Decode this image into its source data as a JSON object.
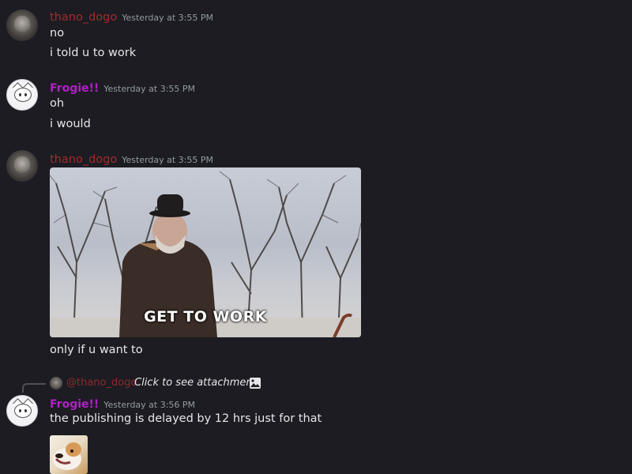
{
  "messages": [
    {
      "username": "thano_dogo",
      "timestamp": "Yesterday at 3:55 PM",
      "lines": [
        "no",
        "i told u to work"
      ]
    },
    {
      "username": "Frogie!!",
      "timestamp": "Yesterday at 3:55 PM",
      "lines": [
        "oh",
        "i would"
      ]
    },
    {
      "username": "thano_dogo",
      "timestamp": "Yesterday at 3:55 PM",
      "gif_caption": "GET TO WORK",
      "lines": [
        "only if u want to"
      ]
    },
    {
      "reply": {
        "mention": "@thano_dogo",
        "text": "Click to see attachment",
        "icon": "image-icon"
      },
      "username": "Frogie!!",
      "timestamp": "Yesterday at 3:56 PM",
      "lines": [
        "the publishing is delayed by 12 hrs just for that"
      ]
    }
  ],
  "colors": {
    "background": "#1c1c22",
    "thano_name": "#a12b2b",
    "frogie_name": "#b41fc9",
    "timestamp": "#949ba4",
    "text": "#e6e6ea"
  }
}
